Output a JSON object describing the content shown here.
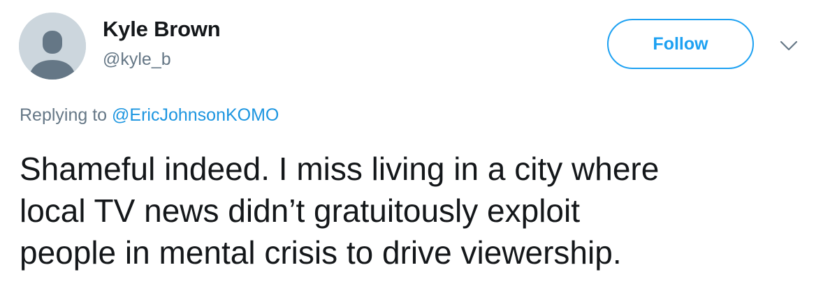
{
  "user": {
    "name": "Kyle Brown",
    "handle": "@kyle_b",
    "avatar_icon": "default-avatar-icon"
  },
  "actions": {
    "follow_label": "Follow",
    "more_icon": "chevron-down-icon"
  },
  "reply": {
    "prefix": "Replying to",
    "mention": "@EricJohnsonKOMO"
  },
  "tweet": {
    "lines": [
      "Shameful indeed. I miss living in a city where",
      "local TV news didn’t gratuitously exploit",
      "people in mental crisis to drive viewership."
    ]
  },
  "colors": {
    "accent": "#1da1f2",
    "link": "#1b95e0",
    "secondary_text": "#657786",
    "primary_text": "#14171a",
    "avatar_bg": "#ccd6dd"
  }
}
